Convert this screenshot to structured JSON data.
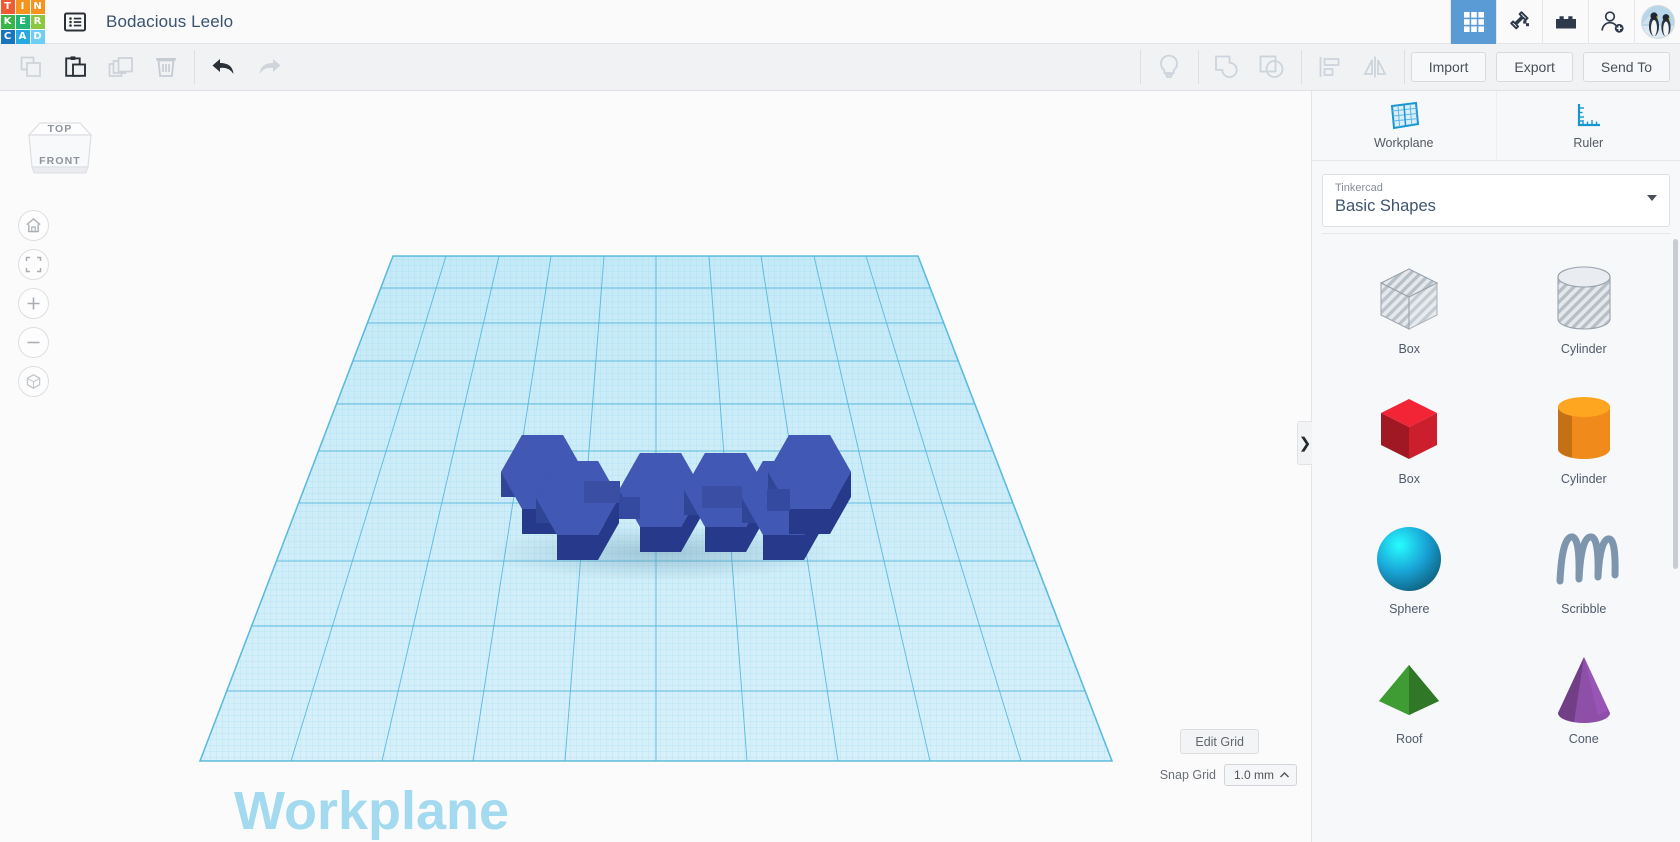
{
  "app": {
    "logo_letters": [
      {
        "ch": "T",
        "color": "#f05a32"
      },
      {
        "ch": "I",
        "color": "#f6921e"
      },
      {
        "ch": "N",
        "color": "#f7941e"
      },
      {
        "ch": "K",
        "color": "#39b54a"
      },
      {
        "ch": "E",
        "color": "#22b573"
      },
      {
        "ch": "R",
        "color": "#8dc63f"
      },
      {
        "ch": "C",
        "color": "#1b75bc"
      },
      {
        "ch": "A",
        "color": "#27aae1"
      },
      {
        "ch": "D",
        "color": "#6dcff6"
      }
    ],
    "document_title": "Bodacious Leelo",
    "doc_menu_icon": "list-menu-icon"
  },
  "topbar_right": {
    "items": [
      {
        "name": "gallery-grid-icon",
        "active": true
      },
      {
        "name": "hammer-tools-icon",
        "active": false
      },
      {
        "name": "lego-brick-icon",
        "active": false
      },
      {
        "name": "invite-person-icon",
        "active": false
      }
    ],
    "avatar_name": "user-avatar-penguins"
  },
  "toolbar": {
    "left_tools": [
      {
        "name": "copy-icon",
        "enabled": false
      },
      {
        "name": "paste-icon",
        "enabled": true
      },
      {
        "name": "duplicate-icon",
        "enabled": false
      },
      {
        "name": "delete-trash-icon",
        "enabled": false
      },
      {
        "name": "undo-icon",
        "enabled": true
      },
      {
        "name": "redo-icon",
        "enabled": false
      }
    ],
    "right_tools": [
      {
        "name": "lightbulb-hint-icon",
        "enabled": false
      },
      {
        "name": "group-shapes-icon",
        "enabled": false
      },
      {
        "name": "ungroup-shapes-icon",
        "enabled": false
      },
      {
        "name": "align-icon",
        "enabled": false
      },
      {
        "name": "mirror-icon",
        "enabled": false
      }
    ],
    "buttons": [
      {
        "label": "Import",
        "name": "import-button"
      },
      {
        "label": "Export",
        "name": "export-button"
      },
      {
        "label": "Send To",
        "name": "send-to-button"
      }
    ]
  },
  "viewport": {
    "viewcube": {
      "top_label": "TOP",
      "front_label": "FRONT"
    },
    "nav_buttons": [
      {
        "name": "home-view-icon"
      },
      {
        "name": "fit-to-view-icon"
      },
      {
        "name": "zoom-in-icon"
      },
      {
        "name": "zoom-out-icon"
      },
      {
        "name": "perspective-toggle-icon"
      }
    ],
    "workplane_watermark": "Workplane",
    "edit_grid_label": "Edit Grid",
    "snap_grid_label": "Snap Grid",
    "snap_grid_value": "1.0 mm",
    "shape_color": "#3b52a8"
  },
  "right_panel": {
    "tabs": [
      {
        "label": "Workplane",
        "name": "workplane-tab",
        "icon": "workplane-grid-icon"
      },
      {
        "label": "Ruler",
        "name": "ruler-tab",
        "icon": "ruler-icon"
      }
    ],
    "library_owner": "Tinkercad",
    "library_name": "Basic Shapes",
    "collapse_arrow": "❯",
    "shapes": [
      {
        "label": "Box",
        "name": "shape-box-hole",
        "art": "box-hole"
      },
      {
        "label": "Cylinder",
        "name": "shape-cylinder-hole",
        "art": "cylinder-hole"
      },
      {
        "label": "Box",
        "name": "shape-box-red",
        "art": "box-solid",
        "color": "#cc1f2e"
      },
      {
        "label": "Cylinder",
        "name": "shape-cylinder-orange",
        "art": "cylinder-solid",
        "color": "#ef8a1b"
      },
      {
        "label": "Sphere",
        "name": "shape-sphere",
        "art": "sphere",
        "color": "#19a3d6"
      },
      {
        "label": "Scribble",
        "name": "shape-scribble",
        "art": "scribble",
        "color": "#7d96ae"
      },
      {
        "label": "Roof",
        "name": "shape-roof",
        "art": "roof",
        "color": "#3f9c35"
      },
      {
        "label": "Cone",
        "name": "shape-cone",
        "art": "cone",
        "color": "#8e4fa8"
      }
    ]
  }
}
